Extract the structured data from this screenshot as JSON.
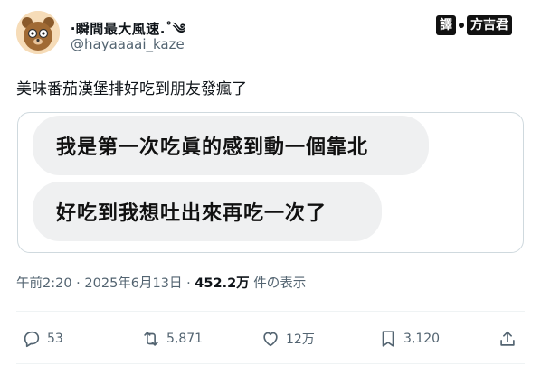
{
  "author": {
    "display_name": "‧瞬間最大風速.˚༄",
    "handle": "@hayaaaai_kaze"
  },
  "watermark": {
    "left": "譯",
    "right": "方吉君"
  },
  "post": {
    "text": "美味番茄漢堡排好吃到朋友發瘋了"
  },
  "chat": {
    "messages": [
      "我是第一次吃眞的感到動一個靠北",
      "好吃到我想吐出來再吃一次了"
    ]
  },
  "meta": {
    "time": "午前2:20 · 2025年6月13日 · ",
    "views": "452.2万",
    "views_suffix": " 件の表示"
  },
  "actions": {
    "replies": "53",
    "reposts": "5,871",
    "likes": "12万",
    "bookmarks": "3,120"
  },
  "colors": {
    "text_secondary": "#536471",
    "bubble_bg": "#eff0f1",
    "border": "#cfd9de"
  },
  "icons": [
    "avatar-bear",
    "reply-icon",
    "repost-icon",
    "like-icon",
    "bookmark-icon",
    "share-icon"
  ]
}
